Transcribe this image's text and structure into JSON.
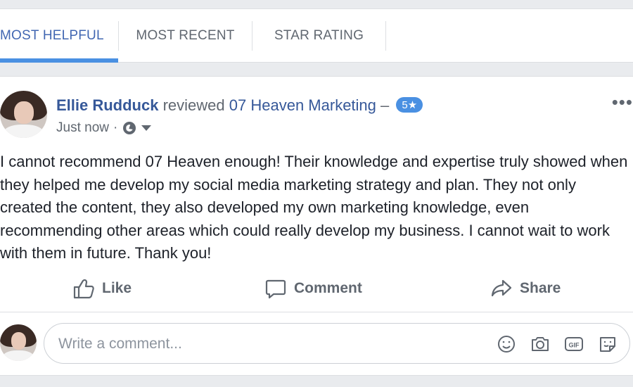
{
  "tabs": [
    {
      "label": "MOST HELPFUL",
      "active": true
    },
    {
      "label": "MOST RECENT",
      "active": false
    },
    {
      "label": "STAR RATING",
      "active": false
    }
  ],
  "post": {
    "author": "Ellie Rudduck",
    "action_text": "reviewed",
    "page_name": "07 Heaven Marketing",
    "dash": "–",
    "rating": "5★",
    "timestamp": "Just now",
    "separator": "·",
    "audience_icon": "globe-icon",
    "body": "I cannot recommend 07 Heaven enough! Their knowledge and expertise truly showed when they helped me develop my social media marketing strategy and plan. They not only created the content, they also developed my own marketing knowledge, even recommending other areas which could really develop my business. I cannot wait to work with them in future. Thank you!",
    "more_label": "•••"
  },
  "actions": {
    "like": "Like",
    "comment": "Comment",
    "share": "Share"
  },
  "comment_box": {
    "placeholder": "Write a comment..."
  },
  "colors": {
    "accent": "#4267b2",
    "link": "#365899",
    "tab_underline": "#4a90e2",
    "badge": "#4a90e2",
    "muted": "#606770"
  }
}
